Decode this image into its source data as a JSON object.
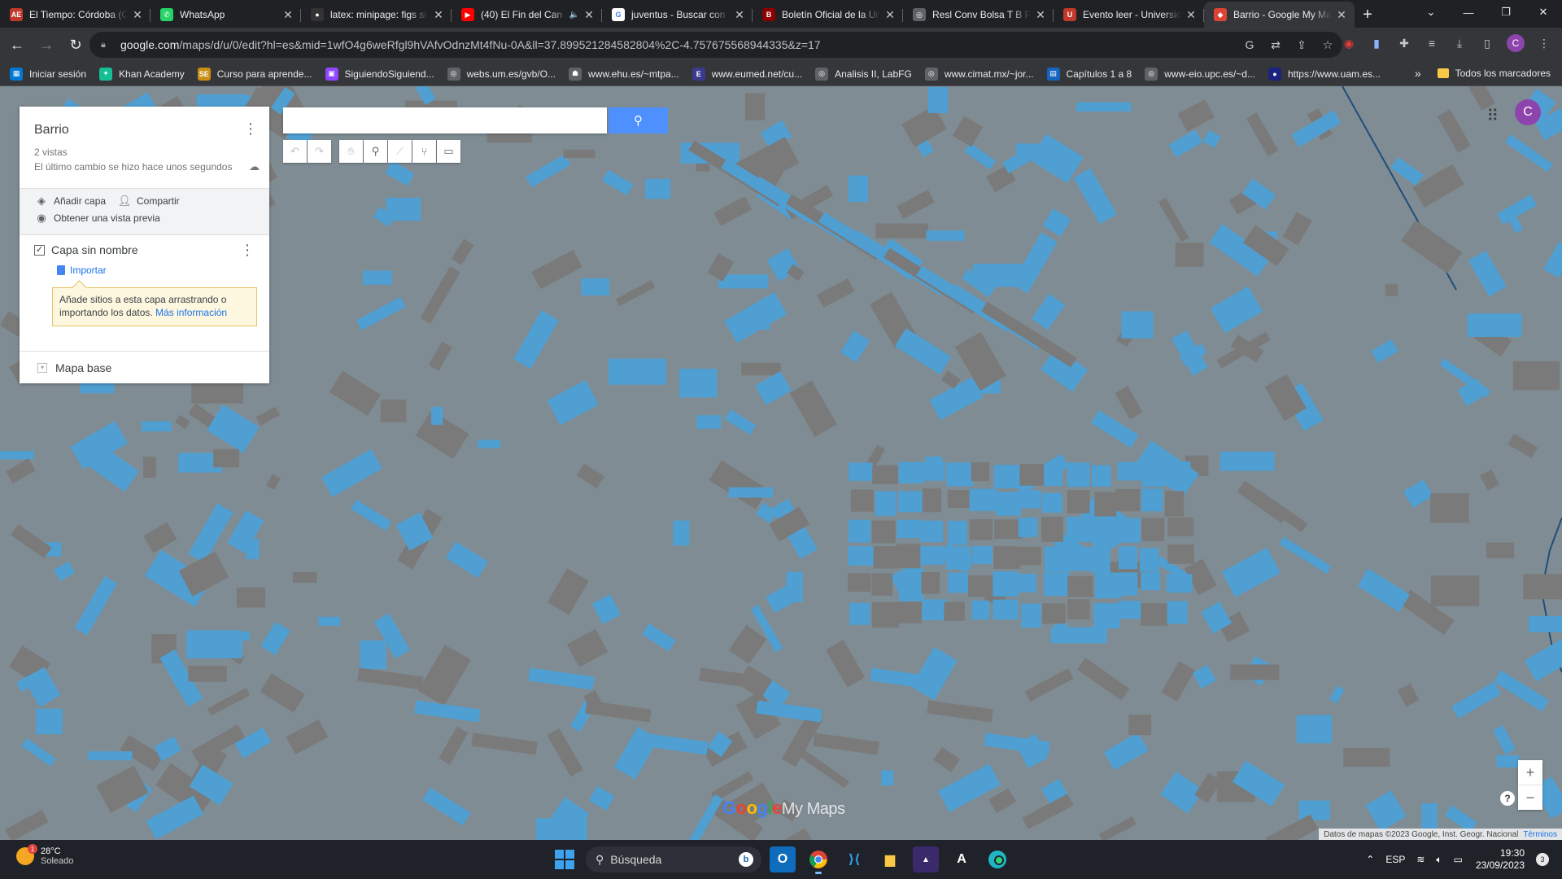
{
  "browser": {
    "tabs": [
      {
        "title": "El Tiempo: Córdoba (C",
        "favicon": "aemet-icon",
        "color": "#c0392b",
        "glyph": "AE"
      },
      {
        "title": "WhatsApp",
        "favicon": "whatsapp-icon",
        "color": "#25d366",
        "glyph": "✆"
      },
      {
        "title": "latex: minipage: figs si",
        "favicon": "github-icon",
        "color": "#333333",
        "glyph": "●"
      },
      {
        "title": "(40) El Fin del Can",
        "favicon": "youtube-icon",
        "color": "#ff0000",
        "glyph": "▶",
        "audio": "🔈"
      },
      {
        "title": "juventus - Buscar con",
        "favicon": "google-icon",
        "color": "#ffffff",
        "glyph": "G"
      },
      {
        "title": "Boletín Oficial de la Ur",
        "favicon": "bo-icon",
        "color": "#8b0000",
        "glyph": "B"
      },
      {
        "title": "Resl Conv Bolsa T B Pr",
        "favicon": "globe-icon",
        "color": "#5f6368",
        "glyph": "◎"
      },
      {
        "title": "Evento leer - Universid",
        "favicon": "uni-icon",
        "color": "#c0392b",
        "glyph": "U"
      },
      {
        "title": "Barrio - Google My Ma",
        "favicon": "mymaps-icon",
        "color": "#db4437",
        "glyph": "◆",
        "active": true
      }
    ],
    "url": "google.com/maps/d/u/0/edit?hl=es&mid=1wfO4g6weRfgl9hVAfvOdnzMt4fNu-0A&ll=37.89952128458280​4%2C-4.757675568944335&z=17",
    "url_domain": "google.com",
    "url_path": "/maps/d/u/0/edit?hl=es&mid=1wfO4g6weRfgl9hVAfvOdnzMt4fNu-0A&ll=37.899521284582804%2C-4.757675568944335&z=17",
    "profile_initial": "C",
    "bookmarks": [
      {
        "label": "Iniciar sesión",
        "color": "#0078d4",
        "glyph": "▦"
      },
      {
        "label": "Khan Academy",
        "color": "#14bf96",
        "glyph": "✦"
      },
      {
        "label": "Curso para aprende...",
        "color": "#c98e14",
        "glyph": "SE"
      },
      {
        "label": "SiguiendoSiguiend...",
        "color": "#9146ff",
        "glyph": "▣"
      },
      {
        "label": "webs.um.es/gvb/O...",
        "color": "#5f6368",
        "glyph": "◎"
      },
      {
        "label": "www.ehu.es/~mtpa...",
        "color": "#5f6368",
        "glyph": "☗"
      },
      {
        "label": "www.eumed.net/cu...",
        "color": "#3a3a8c",
        "glyph": "E"
      },
      {
        "label": "Analisis II, LabFG",
        "color": "#5f6368",
        "glyph": "◎"
      },
      {
        "label": "www.cimat.mx/~jor...",
        "color": "#5f6368",
        "glyph": "◎"
      },
      {
        "label": "Capítulos 1 a 8",
        "color": "#1565c0",
        "glyph": "▤"
      },
      {
        "label": "www-eio.upc.es/~d...",
        "color": "#5f6368",
        "glyph": "◎"
      },
      {
        "label": "https://www.uam.es...",
        "color": "#1a237e",
        "glyph": "●"
      }
    ],
    "bookmarks_overflow": "»",
    "all_bookmarks": "Todos los marcadores"
  },
  "mymaps": {
    "map_title": "Barrio",
    "views": "2 vistas",
    "last_change": "El último cambio se hizo hace unos segundos",
    "add_layer": "Añadir capa",
    "share": "Compartir",
    "preview": "Obtener una vista previa",
    "layer_name": "Capa sin nombre",
    "import": "Importar",
    "tip_text": "Añade sitios a esta capa arrastrando o importando los datos.",
    "tip_link": "Más información",
    "base_map": "Mapa base",
    "search_placeholder": "",
    "logo_google": "Google",
    "logo_mymaps": "My Maps",
    "attribution": "Datos de mapas ©2023 Google, Inst. Geogr. Nacional",
    "terms": "Términos",
    "avatar_initial": "C",
    "zoom_in": "+",
    "zoom_out": "−",
    "help": "?"
  },
  "taskbar": {
    "temperature": "28°C",
    "condition": "Soleado",
    "weather_badge": "1",
    "search_label": "Búsqueda",
    "language": "ESP",
    "time": "19:30",
    "date": "23/09/2023",
    "notifications": "3"
  },
  "colors": {
    "map_background": "#7f8c93",
    "building_blue": "#4f9fd3",
    "building_gray": "#7a7a7a"
  }
}
